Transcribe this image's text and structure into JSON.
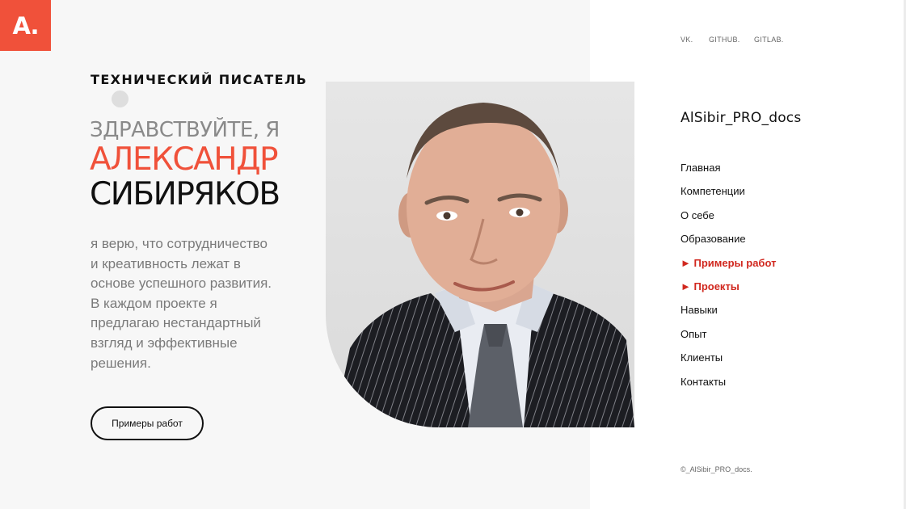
{
  "logo": {
    "text": "A."
  },
  "hero": {
    "role": "ТЕХНИЧЕСКИЙ ПИСАТЕЛЬ",
    "greeting": "ЗДРАВСТВУЙТЕ, Я",
    "first_name": "АЛЕКСАНДР",
    "last_name": "СИБИРЯКОВ",
    "bio": "я верю, что сотрудничество и креативность лежат в основе успешного развития. В каждом проекте я предлагаю нестандартный взгляд и эффективные решения.",
    "cta_label": "Примеры работ"
  },
  "social": [
    "VK.",
    "GITHUB.",
    "GITLAB."
  ],
  "brand": "AlSibir_PRO_docs",
  "nav": [
    {
      "label": "Главная"
    },
    {
      "label": "Компетенции"
    },
    {
      "label": "О себе"
    },
    {
      "label": "Образование"
    },
    {
      "label": "► Примеры работ",
      "active": true
    },
    {
      "label": "► Проекты",
      "active": true
    },
    {
      "label": "Навыки"
    },
    {
      "label": "Опыт"
    },
    {
      "label": "Клиенты"
    },
    {
      "label": "Контакты"
    }
  ],
  "footer": {
    "copyright": "©_AlSibir_PRO_docs."
  },
  "colors": {
    "accent": "#f0513a",
    "nav_active": "#d1281f",
    "text": "#111111",
    "muted": "#7a7a7a"
  }
}
